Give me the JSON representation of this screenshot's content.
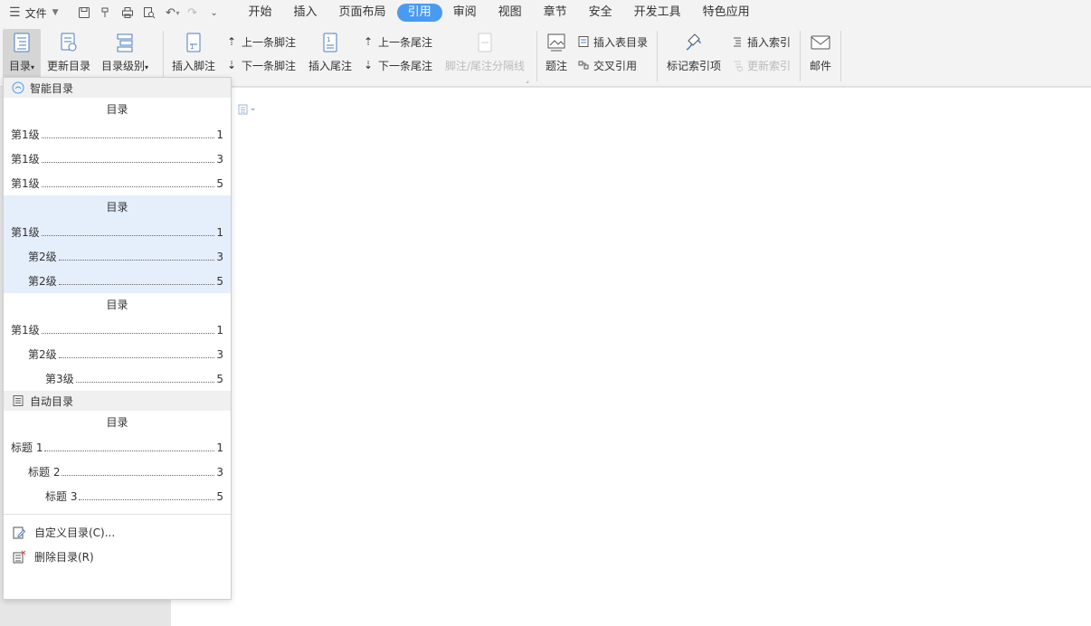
{
  "menubar": {
    "file_label": "文件",
    "tabs": [
      {
        "label": "开始"
      },
      {
        "label": "插入"
      },
      {
        "label": "页面布局"
      },
      {
        "label": "引用"
      },
      {
        "label": "审阅"
      },
      {
        "label": "视图"
      },
      {
        "label": "章节"
      },
      {
        "label": "安全"
      },
      {
        "label": "开发工具"
      },
      {
        "label": "特色应用"
      }
    ],
    "active_tab": "引用"
  },
  "ribbon": {
    "toc": "目录",
    "update_toc": "更新目录",
    "toc_level": "目录级别",
    "insert_footnote": "插入脚注",
    "prev_footnote": "上一条脚注",
    "next_footnote": "下一条脚注",
    "insert_endnote": "插入尾注",
    "prev_endnote": "上一条尾注",
    "next_endnote": "下一条尾注",
    "separator_line": "脚注/尾注分隔线",
    "caption": "题注",
    "insert_table_of_figures": "插入表目录",
    "cross_reference": "交叉引用",
    "mark_index_entry": "标记索引项",
    "insert_index": "插入索引",
    "update_index": "更新索引",
    "mail": "邮件"
  },
  "dropdown": {
    "smart_section": "智能目录",
    "smart_tocs": [
      {
        "title": "目录",
        "rows": [
          {
            "label": "第1级",
            "page": "1",
            "indent": 0
          },
          {
            "label": "第1级",
            "page": "3",
            "indent": 0
          },
          {
            "label": "第1级",
            "page": "5",
            "indent": 0
          }
        ]
      },
      {
        "title": "目录",
        "rows": [
          {
            "label": "第1级",
            "page": "1",
            "indent": 0
          },
          {
            "label": "第2级",
            "page": "3",
            "indent": 1
          },
          {
            "label": "第2级",
            "page": "5",
            "indent": 1
          }
        ]
      },
      {
        "title": "目录",
        "rows": [
          {
            "label": "第1级",
            "page": "1",
            "indent": 0
          },
          {
            "label": "第2级",
            "page": "3",
            "indent": 1
          },
          {
            "label": "第3级",
            "page": "5",
            "indent": 2
          }
        ]
      }
    ],
    "auto_section": "自动目录",
    "auto_toc": {
      "title": "目录",
      "rows": [
        {
          "label": "标题 1",
          "page": "1",
          "indent": 0
        },
        {
          "label": "标题 2",
          "page": "3",
          "indent": 1
        },
        {
          "label": "标题 3",
          "page": "5",
          "indent": 2
        }
      ]
    },
    "custom_toc": "自定义目录(C)...",
    "delete_toc": "删除目录(R)"
  },
  "colors": {
    "accent": "#4a9bf0",
    "highlight": "#e5eefb"
  }
}
